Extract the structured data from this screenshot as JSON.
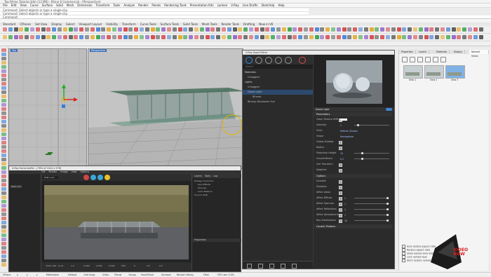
{
  "app": {
    "title": "Top-Rhino Tutorial.3dm (13 MB) - Rhino 6 Commercial - [Perspective]",
    "cmd_lines": [
      "Command: Select objects or type a single-clip",
      "Command: Select objects or type a single-clip",
      "Command:"
    ]
  },
  "menu": [
    "File",
    "Edit",
    "View",
    "Curve",
    "Surface",
    "Solid",
    "Mesh",
    "Dimension",
    "Transform",
    "Tools",
    "Analyze",
    "Render",
    "Panels",
    "Rendering Tools",
    "Presentation Kits",
    "Lumion",
    "V-Ray",
    "Line Drafts",
    "SketchUp",
    "Help"
  ],
  "tabs": [
    "Standard",
    "CPlanes",
    "Set View",
    "Display",
    "Select",
    "Viewport Layout",
    "Visibility",
    "Transform",
    "Curve Tools",
    "Surface Tools",
    "Solid Tools",
    "Mesh Tools",
    "Render Tools",
    "Drafting",
    "New in V6"
  ],
  "viewports": {
    "top_label": "Top",
    "persp_label": "Perspective"
  },
  "frame_buffer": {
    "title": "V-Ray frame buffer - [78% of 1024 x 576]",
    "menu": [
      "File",
      "Render",
      "Image",
      "View",
      "Options"
    ],
    "channel": "RGB color",
    "tabs": [
      "Layers",
      "Stats",
      "Log"
    ],
    "layers": [
      "Display Correction",
      "Lens Effects",
      "Denoise",
      "Color Balance",
      "Source: RGB"
    ],
    "properties_label": "Properties",
    "status": [
      "1024, 349",
      "[1.0]",
      "1.0",
      "0.000",
      "0.000",
      "0.000",
      "HSV",
      "0",
      "0.0",
      "0.0"
    ]
  },
  "asset_editor": {
    "title": "V-Ray Asset Editor",
    "search_placeholder": "Search",
    "tree": [
      {
        "label": "Materials",
        "kind": "header"
      },
      {
        "label": "Unlogged",
        "kind": "item"
      },
      {
        "label": "Lights",
        "kind": "header"
      },
      {
        "label": "Unlogged",
        "kind": "item"
      },
      {
        "label": "Dome Light",
        "kind": "selected"
      },
      {
        "label": "Bitmap",
        "kind": "sub"
      },
      {
        "label": "Bitmap Bluewater Sun",
        "kind": "item"
      }
    ],
    "light_name": "Dome Light",
    "parameters_header": "Parameters",
    "params": [
      {
        "label": "Color/ Texture HDR",
        "value": ""
      },
      {
        "label": "Intensity",
        "value": "1"
      },
      {
        "label": "Units",
        "value": "Default (Scalar)"
      },
      {
        "label": "Shape",
        "value": "Hemisphere"
      },
      {
        "label": "Follow Shadow",
        "value": ""
      },
      {
        "label": "Radius",
        "value": ""
      },
      {
        "label": "Projection Height",
        "value": "10"
      },
      {
        "label": "Ground Blend",
        "value": "0.2"
      },
      {
        "label": "Use Transform",
        "value": ""
      },
      {
        "label": "Adaptive",
        "value": ""
      }
    ],
    "options_header": "Options",
    "options": [
      {
        "label": "Invisible",
        "value": ""
      },
      {
        "label": "Shadows",
        "value": ""
      },
      {
        "label": "Affect Alpha",
        "value": ""
      },
      {
        "label": "Affect Diffuse",
        "value": "1"
      },
      {
        "label": "Affect Specular",
        "value": "1"
      },
      {
        "label": "Affect Reflections",
        "value": "1"
      },
      {
        "label": "Affect Atmospherics",
        "value": "1"
      },
      {
        "label": "Ray Subdivisions",
        "value": "10"
      }
    ],
    "caustic_header": "Caustic Photons"
  },
  "right_panel": {
    "tabs": [
      "Properties",
      "Layers",
      "Materials",
      "Display",
      "Named Views"
    ],
    "views": [
      "View 1",
      "View 2",
      "View 3"
    ],
    "checkboxes": [
      "Auto restore aspect ratio",
      "Restore aspect ratio",
      "Show named view widgets",
      "Lock named view",
      "Don't restore named view widget"
    ]
  },
  "statusbar": [
    "CPlane",
    "x",
    "y",
    "z",
    "Millimeters",
    "Default",
    "Grid Snap",
    "Ortho",
    "Planar",
    "Osnap",
    "SmartTrack",
    "Gumball",
    "Record History",
    "Filter",
    "CPU use: 0.5%"
  ],
  "watermark": "VIDEO NOW"
}
